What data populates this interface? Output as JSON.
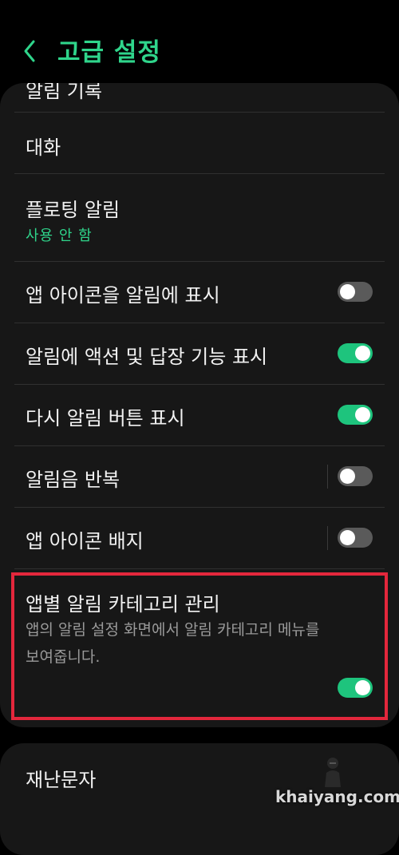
{
  "header": {
    "title": "고급 설정"
  },
  "card": {
    "partial_top_label": "알림 기록",
    "items": [
      {
        "label": "대화"
      },
      {
        "label": "플로팅 알림",
        "value": "사용 안 함"
      },
      {
        "label": "앱 아이콘을 알림에 표시",
        "toggle": false
      },
      {
        "label": "알림에 액션 및 답장 기능 표시",
        "toggle": true
      },
      {
        "label": "다시 알림 버튼 표시",
        "toggle": true
      },
      {
        "label": "알림음 반복",
        "toggle": false
      },
      {
        "label": "앱 아이콘 배지",
        "toggle": false
      },
      {
        "label": "앱별 알림 카테고리 관리",
        "description_line1": "앱의 알림 설정 화면에서 알림 카테고리 메뉴를",
        "description_line2": "보여줍니다.",
        "toggle": true
      }
    ]
  },
  "card2": {
    "items": [
      {
        "label": "재난문자"
      }
    ]
  },
  "watermark": "khaiyang.com",
  "colors": {
    "accent": "#2fd58b",
    "toggle_on": "#1ec47d",
    "toggle_off": "#5a5a5a",
    "highlight": "#e3273c",
    "card_bg": "#171717"
  },
  "icons": {
    "back": "chevron-left-icon"
  }
}
